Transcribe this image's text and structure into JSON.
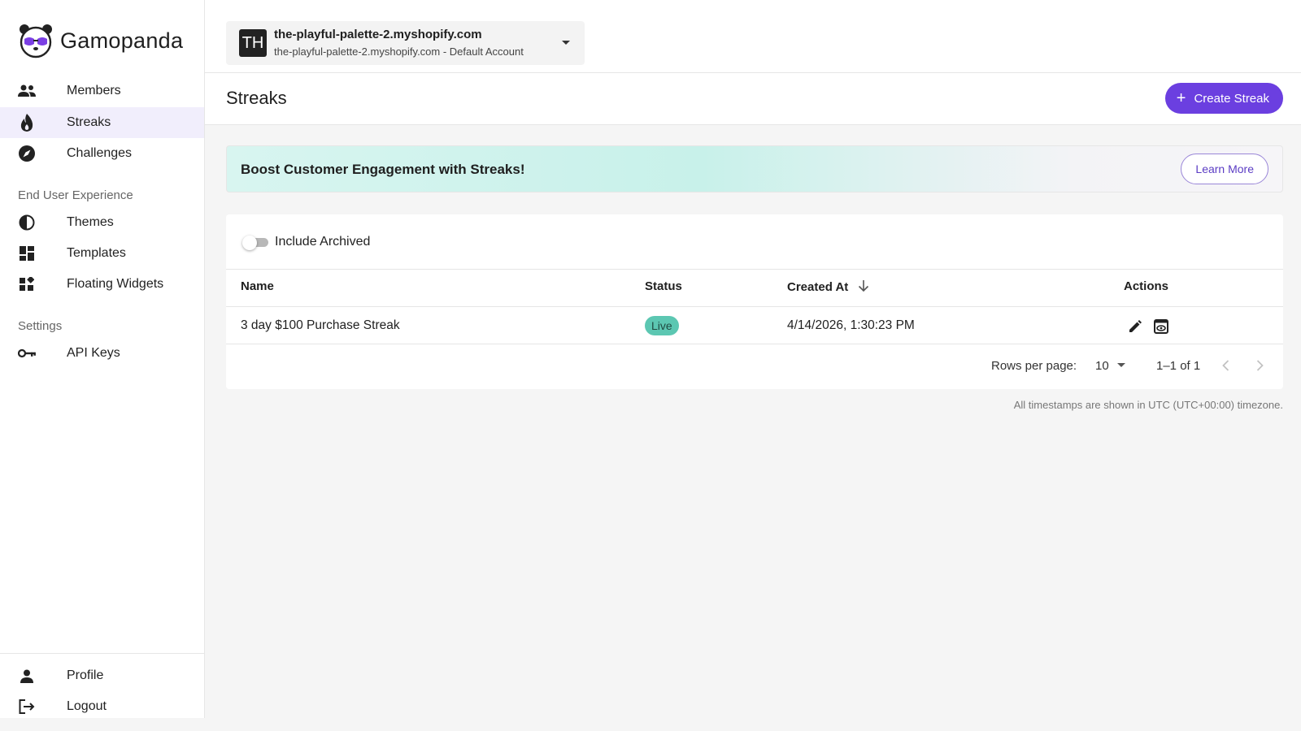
{
  "brand": {
    "name": "Gamopanda"
  },
  "sidebar": {
    "items": [
      {
        "label": "Members",
        "icon": "people-icon"
      },
      {
        "label": "Streaks",
        "icon": "fire-icon",
        "active": true
      },
      {
        "label": "Challenges",
        "icon": "compass-icon"
      }
    ],
    "section_experience": "End User Experience",
    "experience_items": [
      {
        "label": "Themes",
        "icon": "contrast-icon"
      },
      {
        "label": "Templates",
        "icon": "dashboard-icon"
      },
      {
        "label": "Floating Widgets",
        "icon": "widgets-icon"
      }
    ],
    "section_settings": "Settings",
    "settings_items": [
      {
        "label": "API Keys",
        "icon": "key-icon"
      }
    ],
    "bottom_items": [
      {
        "label": "Profile",
        "icon": "person-icon"
      },
      {
        "label": "Logout",
        "icon": "logout-icon"
      }
    ]
  },
  "account": {
    "initials": "TH",
    "store": "the-playful-palette-2.myshopify.com",
    "subtitle": "the-playful-palette-2.myshopify.com - Default Account"
  },
  "page": {
    "title": "Streaks",
    "create_label": "Create Streak"
  },
  "banner": {
    "message": "Boost Customer Engagement with Streaks!",
    "button_label": "Learn More"
  },
  "filters": {
    "include_archived_label": "Include Archived",
    "include_archived": false
  },
  "table": {
    "columns": [
      "Name",
      "Status",
      "Created At",
      "Actions"
    ],
    "rows": [
      {
        "name": "3 day $100 Purchase Streak",
        "status": "Live",
        "created_at": "4/14/2026, 1:30:23 PM"
      }
    ],
    "rows_per_page_label": "Rows per page:",
    "rows_per_page": "10",
    "range": "1–1 of 1"
  },
  "timezone_note": "All timestamps are shown in UTC (UTC+00:00) timezone.",
  "colors": {
    "accent": "#6b3fe0",
    "active_nav_bg": "#f1eefc",
    "live_badge": "#5cc7b2"
  }
}
